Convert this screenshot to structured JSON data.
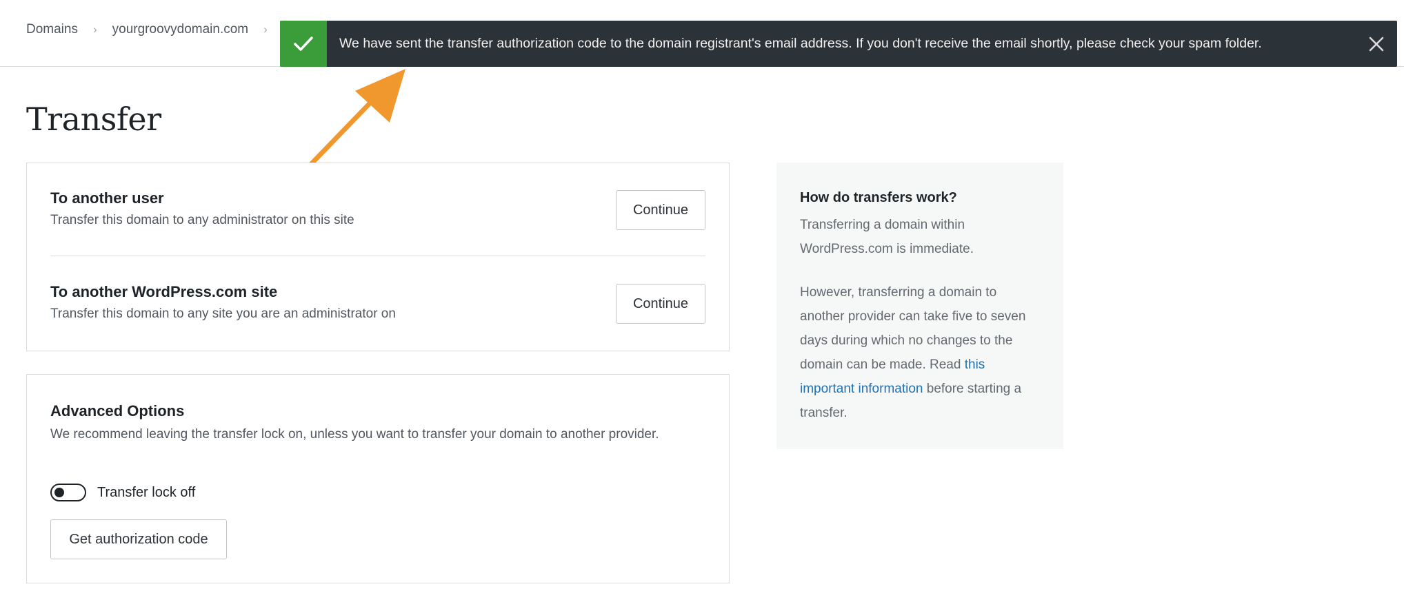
{
  "breadcrumb": {
    "items": [
      "Domains",
      "yourgroovydomain.com"
    ]
  },
  "notice": {
    "status": "success",
    "message": "We have sent the transfer authorization code to the domain registrant's email address. If you don't receive the email shortly, please check your spam folder.",
    "colors": {
      "background": "#2c3338",
      "icon_bg": "#3a9d3a"
    }
  },
  "annotation": {
    "arrow_color": "#f0982e"
  },
  "page": {
    "title": "Transfer"
  },
  "transfer_options": [
    {
      "title": "To another user",
      "description": "Transfer this domain to any administrator on this site",
      "button": "Continue"
    },
    {
      "title": "To another WordPress.com site",
      "description": "Transfer this domain to any site you are an administrator on",
      "button": "Continue"
    }
  ],
  "advanced": {
    "title": "Advanced Options",
    "description": "We recommend leaving the transfer lock on, unless you want to transfer your domain to another provider.",
    "toggle_label": "Transfer lock off",
    "toggle_on": false,
    "button": "Get authorization code"
  },
  "help": {
    "title": "How do transfers work?",
    "p1": "Transferring a domain within WordPress.com is immediate.",
    "p2_before": "However, transferring a domain to another provider can take five to seven days during which no changes to the domain can be made. Read ",
    "p2_link": "this important information",
    "p2_after": " before starting a transfer."
  }
}
